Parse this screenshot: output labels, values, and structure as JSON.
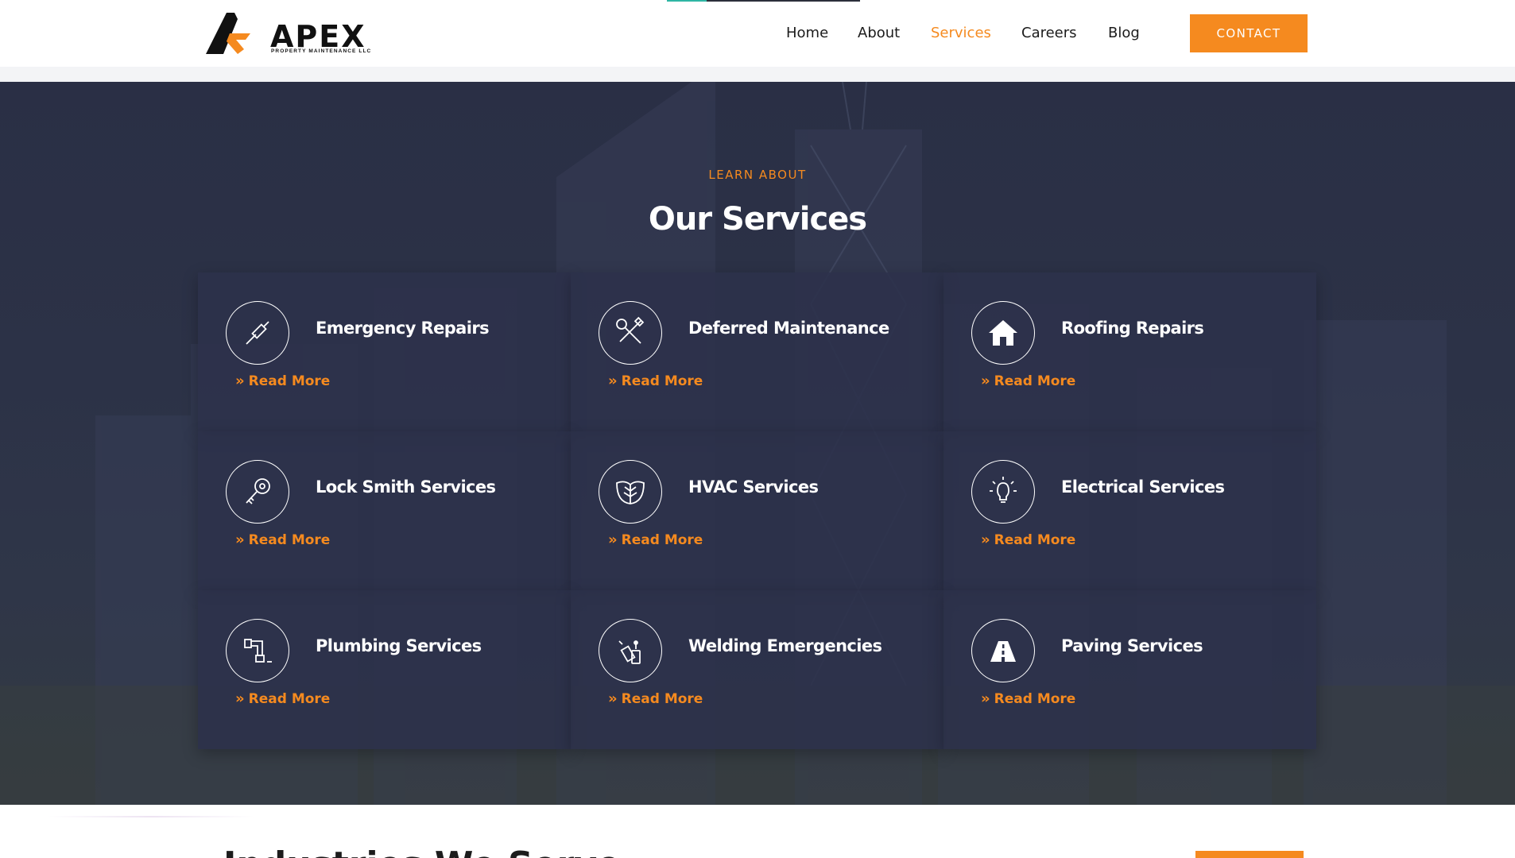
{
  "brand": {
    "name": "APEX",
    "tagline": "PROPERTY MAINTENANCE LLC",
    "accent": "#f58a1f",
    "dark": "#111111"
  },
  "nav": {
    "items": [
      {
        "label": "Home"
      },
      {
        "label": "About"
      },
      {
        "label": "Services"
      },
      {
        "label": "Careers"
      },
      {
        "label": "Blog"
      }
    ],
    "active": "Services",
    "cta_label": "CONTACT"
  },
  "services": {
    "eyebrow": "LEARN ABOUT",
    "title": "Our Services",
    "read_more_label": "Read More",
    "items": [
      {
        "title": "Emergency Repairs",
        "icon": "screwdriver-icon"
      },
      {
        "title": "Deferred Maintenance",
        "icon": "wrench-screwdriver-icon"
      },
      {
        "title": "Roofing Repairs",
        "icon": "house-icon"
      },
      {
        "title": "Lock Smith Services",
        "icon": "key-icon"
      },
      {
        "title": "HVAC Services",
        "icon": "leaf-icon"
      },
      {
        "title": "Electrical Services",
        "icon": "light-bulb-icon"
      },
      {
        "title": "Plumbing Services",
        "icon": "pipe-icon"
      },
      {
        "title": "Welding Emergencies",
        "icon": "welding-torch-icon"
      },
      {
        "title": "Paving Services",
        "icon": "road-icon"
      }
    ]
  },
  "next_section": {
    "heading": "Industries We Serve"
  },
  "colors": {
    "section_bg": "#2c3247",
    "card_bg": "#2c314a",
    "text_light": "#ffffff"
  }
}
